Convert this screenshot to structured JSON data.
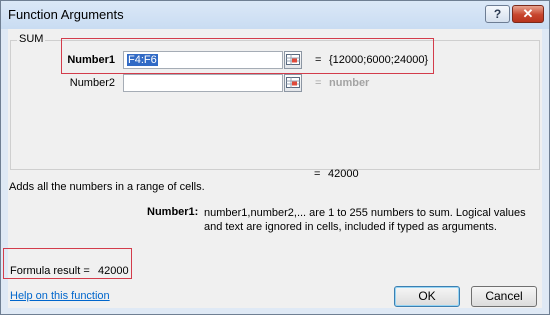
{
  "window": {
    "title": "Function Arguments",
    "help_button": "?",
    "close_button": "✕"
  },
  "function": {
    "name": "SUM",
    "args": [
      {
        "label": "Number1",
        "value": "F4:F6",
        "result": "{12000;6000;24000}"
      },
      {
        "label": "Number2",
        "value": "",
        "result": "number"
      }
    ],
    "equals": "=",
    "total": "42000",
    "description": "Adds all the numbers in a range of cells.",
    "arg_help_label": "Number1:",
    "arg_help_text": "number1,number2,... are 1 to 255 numbers to sum. Logical values and text are ignored in cells, included if typed as arguments."
  },
  "formula_result": {
    "label": "Formula result =",
    "value": "42000"
  },
  "footer": {
    "help_link": "Help on this function",
    "ok_label": "OK",
    "cancel_label": "Cancel"
  },
  "colors": {
    "highlight": "#d33c4b",
    "link": "#0066cc",
    "selection": "#316ac5"
  }
}
